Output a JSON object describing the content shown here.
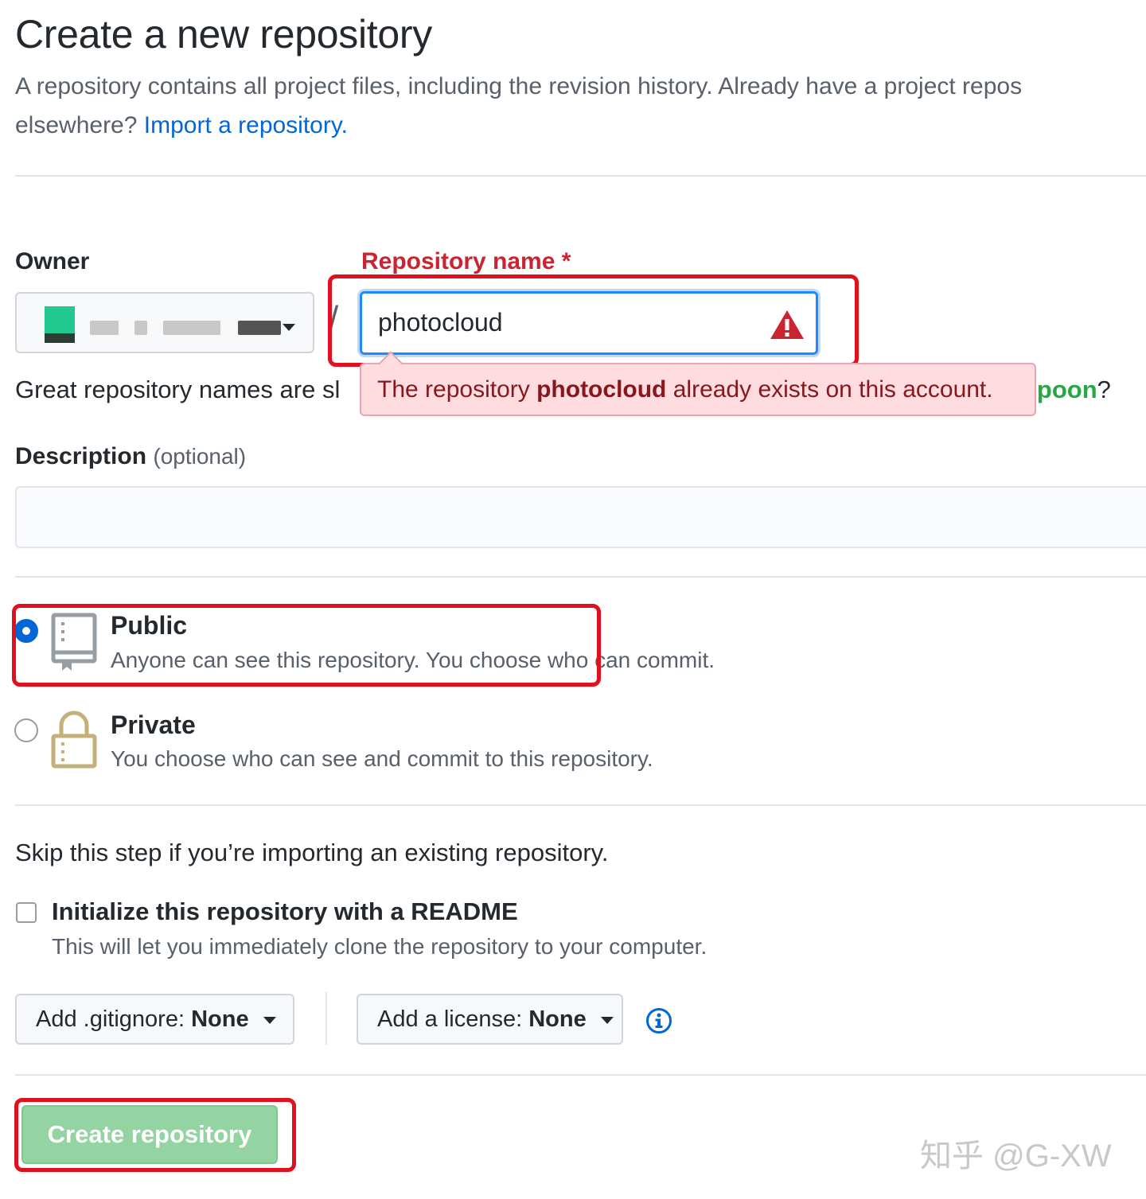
{
  "header": {
    "title": "Create a new repository",
    "intro_line1": "A repository contains all project files, including the revision history. Already have a project repos",
    "intro_prefix": "elsewhere? ",
    "import_link": "Import a repository."
  },
  "owner": {
    "label": "Owner"
  },
  "repo_name": {
    "label": "Repository name",
    "required_mark": "*",
    "value": "photocloud",
    "separator": "/"
  },
  "hint": {
    "prefix": "Great repository names are sl",
    "suggestion_suffix": "-spoon",
    "question_mark": "?"
  },
  "error": {
    "before": "The repository ",
    "name": "photocloud",
    "after": " already exists on this account."
  },
  "description": {
    "label": "Description",
    "optional": "(optional)",
    "value": ""
  },
  "visibility": {
    "selected": "public",
    "options": [
      {
        "title": "Public",
        "desc": "Anyone can see this repository. You choose who can commit."
      },
      {
        "title": "Private",
        "desc": "You choose who can see and commit to this repository."
      }
    ]
  },
  "init": {
    "skip_text": "Skip this step if you’re importing an existing repository.",
    "readme_label": "Initialize this repository with a README",
    "readme_desc": "This will let you immediately clone the repository to your computer.",
    "readme_checked": false
  },
  "selects": {
    "gitignore_label": "Add .gitignore: ",
    "gitignore_value": "None",
    "license_label": "Add a license: ",
    "license_value": "None"
  },
  "actions": {
    "create_label": "Create repository"
  },
  "watermark": "知乎 @G-XW",
  "colors": {
    "link": "#0366d6",
    "error_red": "#cb2431",
    "highlight_box": "#e0101f",
    "create_button": "#94d3a2",
    "suggestion_green": "#28a745"
  }
}
